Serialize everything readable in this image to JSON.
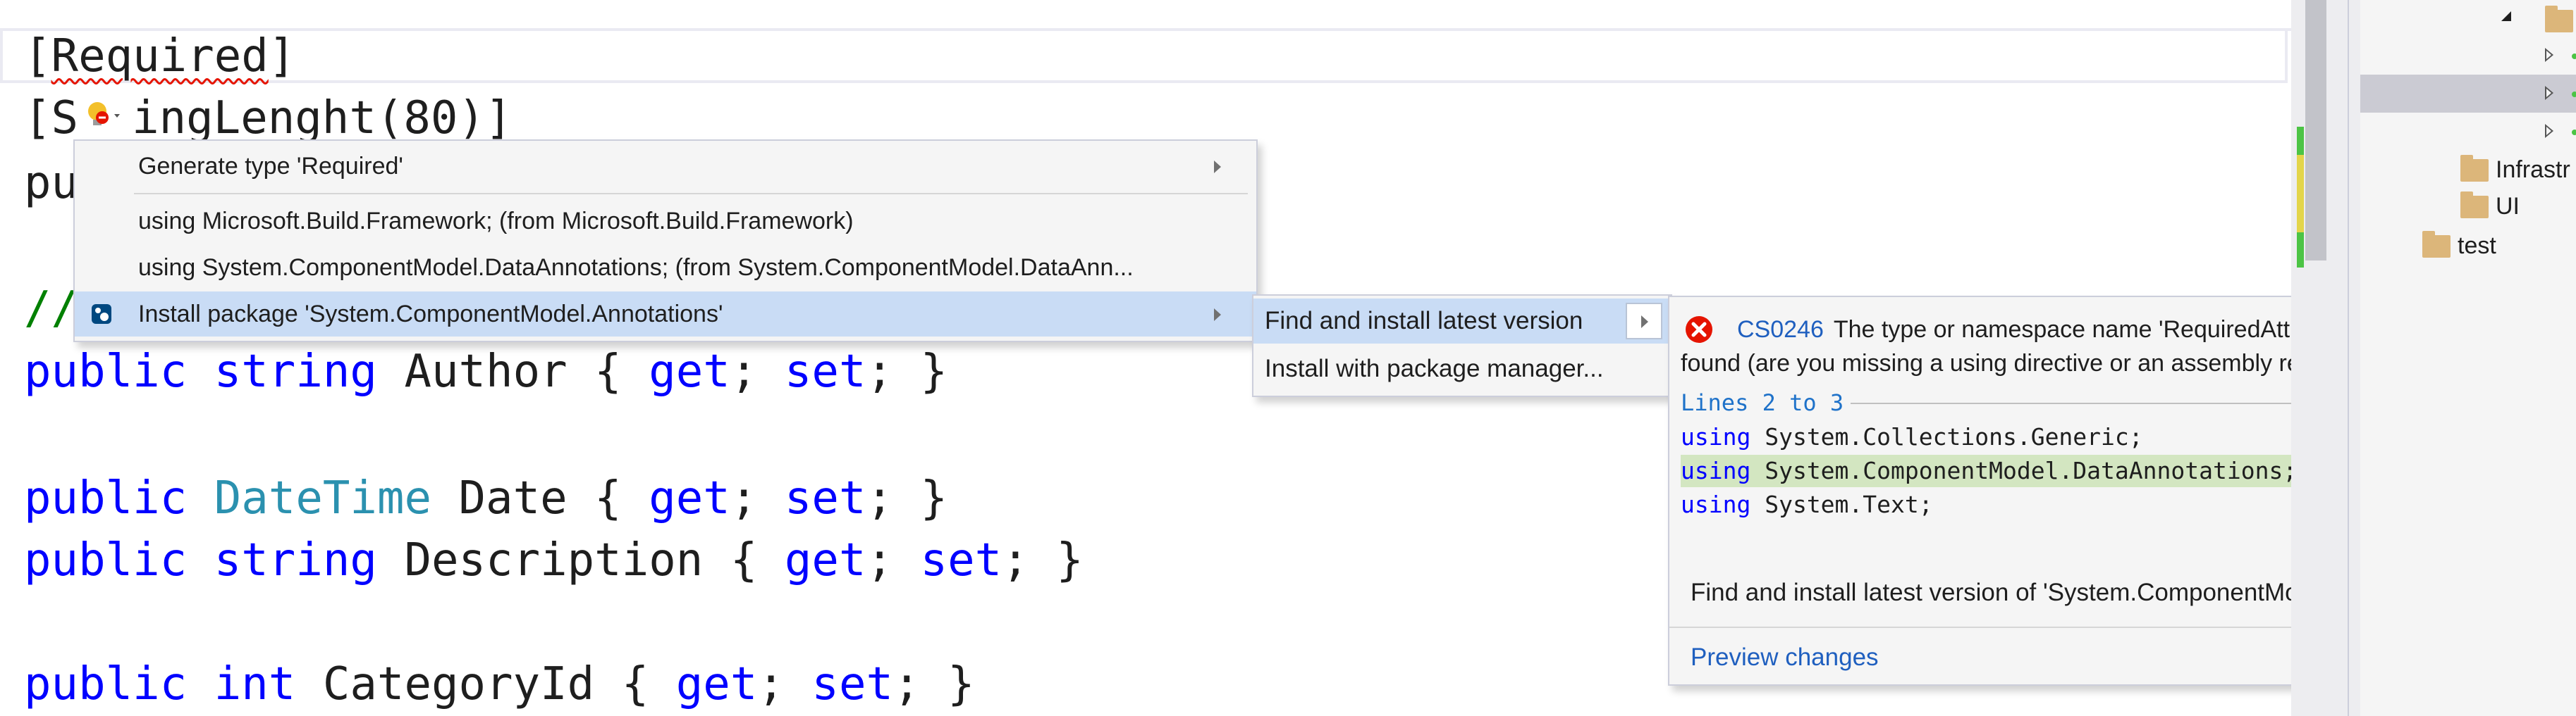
{
  "editor": {
    "lines": {
      "l1": "[Required]",
      "l2_a": "[S",
      "l2_b": "ingLenght(80)]",
      "l3": "pu",
      "l4": "//",
      "l5": {
        "kw1": "public",
        "kw2": "string",
        "name": "Author",
        "open": " { ",
        "get": "get",
        "semi1": "; ",
        "set": "set",
        "close": "; }"
      },
      "l6": {
        "kw1": "public",
        "type": "DateTime",
        "name": "Date",
        "open": " { ",
        "get": "get",
        "semi1": "; ",
        "set": "set",
        "close": "; }"
      },
      "l7": {
        "kw1": "public",
        "kw2": "string",
        "name": "Description",
        "open": " { ",
        "get": "get",
        "semi1": "; ",
        "set": "set",
        "close": "; }"
      },
      "l8": {
        "kw1": "public",
        "kw2": "int",
        "name": "CategoryId",
        "open": " { ",
        "get": "get",
        "semi1": "; ",
        "set": "set",
        "close": "; }"
      }
    }
  },
  "quick_actions_menu": {
    "items": [
      {
        "label": "Generate type 'Required'",
        "has_submenu": true
      },
      {
        "label": "using Microsoft.Build.Framework; (from Microsoft.Build.Framework)",
        "has_submenu": false
      },
      {
        "label": "using System.ComponentModel.DataAnnotations; (from System.ComponentModel.DataAnn...",
        "has_submenu": false
      },
      {
        "label": "Install package 'System.ComponentModel.Annotations'",
        "has_submenu": true,
        "selected": true,
        "icon": "nuget-package-icon"
      }
    ]
  },
  "submenu": {
    "items": [
      {
        "label": "Find and install latest version",
        "selected": true
      },
      {
        "label": "Install with package manager..."
      }
    ]
  },
  "preview": {
    "error_code": "CS0246",
    "error_message": "The type or namespace name 'RequiredAttribute' could not be found (are you missing a using directive or an assembly reference?)",
    "lines_header": "Lines 2 to 3",
    "code_lines": [
      {
        "kw": "using",
        "text": " System.Collections.Generic;",
        "highlight": false
      },
      {
        "kw": "using",
        "text": " System.ComponentModel.DataAnnotations;",
        "highlight": true
      },
      {
        "kw": "using",
        "text": " System.Text;",
        "highlight": false
      }
    ],
    "description": "Find and install latest version of 'System.ComponentModel.Annotations'",
    "link": "Preview changes"
  },
  "solution_explorer": {
    "folders": [
      "Infrastr",
      "UI",
      "test"
    ]
  },
  "colors": {
    "keyword": "#0000ff",
    "type": "#2b91af",
    "comment": "#008000",
    "error": "#e51400",
    "selection": "#c9dcf5",
    "diff_added": "#d3e6c1",
    "link": "#1f5fbf"
  }
}
